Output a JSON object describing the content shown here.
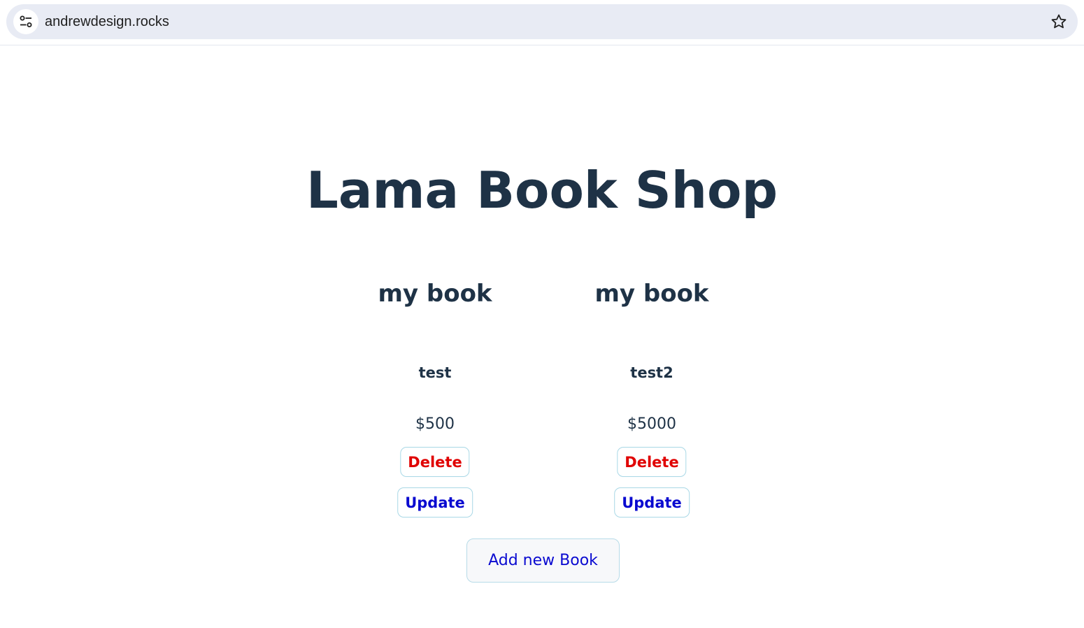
{
  "browser": {
    "url": "andrewdesign.rocks"
  },
  "page": {
    "title": "Lama Book Shop",
    "add_button_label": "Add new Book"
  },
  "books": [
    {
      "title": "my book",
      "desc": "test",
      "price": "$500",
      "delete_label": "Delete",
      "update_label": "Update"
    },
    {
      "title": "my book",
      "desc": "test2",
      "price": "$5000",
      "delete_label": "Delete",
      "update_label": "Update"
    }
  ],
  "colors": {
    "heading": "#1e3246",
    "delete": "#e00000",
    "link": "#0a0ad0",
    "button_border": "#a9d8e6"
  },
  "icons": {
    "site_info": "tune-icon",
    "bookmark": "star-outline-icon"
  }
}
